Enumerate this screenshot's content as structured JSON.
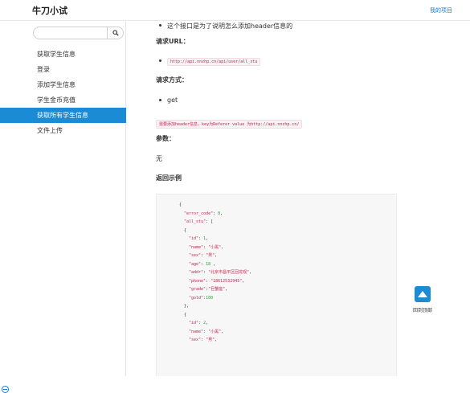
{
  "header": {
    "brand": "牛刀小试",
    "my_projects": "我的项目"
  },
  "sidebar": {
    "search_value": "",
    "items": [
      {
        "label": "获取学生信息",
        "active": false
      },
      {
        "label": "登录",
        "active": false
      },
      {
        "label": "添加学生信息",
        "active": false
      },
      {
        "label": "学生金币充值",
        "active": false
      },
      {
        "label": "获取所有学生信息",
        "active": true
      },
      {
        "label": "文件上传",
        "active": false
      }
    ]
  },
  "content": {
    "intro_bullet": "这个接口是为了说明怎么添加header信息的",
    "url_heading": "请求URL：",
    "url": "http://api.nnzhp.cn/api/user/all_stu",
    "method_heading": "请求方式：",
    "method": "get",
    "note": "需要添加header信息，key为Referer value 为http://api.nnzhp.cn/",
    "params_heading": "参数：",
    "params": "无",
    "example_heading": "返回示例",
    "code_lines": [
      {
        "indent": 0,
        "parts": [
          {
            "t": "{",
            "c": ""
          }
        ]
      },
      {
        "indent": 1,
        "parts": [
          {
            "t": "\"error_code\"",
            "c": "k"
          },
          {
            "t": ": ",
            "c": ""
          },
          {
            "t": "0",
            "c": "n"
          },
          {
            "t": ",",
            "c": ""
          }
        ]
      },
      {
        "indent": 1,
        "parts": [
          {
            "t": "\"all_stu\"",
            "c": "k"
          },
          {
            "t": ": [",
            "c": ""
          }
        ]
      },
      {
        "indent": 1,
        "parts": [
          {
            "t": "{",
            "c": ""
          }
        ]
      },
      {
        "indent": 2,
        "parts": [
          {
            "t": "\"id\"",
            "c": "k"
          },
          {
            "t": ": ",
            "c": ""
          },
          {
            "t": "1",
            "c": "n"
          },
          {
            "t": ",",
            "c": ""
          }
        ]
      },
      {
        "indent": 2,
        "parts": [
          {
            "t": "\"name\"",
            "c": "k"
          },
          {
            "t": ": ",
            "c": ""
          },
          {
            "t": "\"小黑\"",
            "c": "s"
          },
          {
            "t": ",",
            "c": ""
          }
        ]
      },
      {
        "indent": 2,
        "parts": [
          {
            "t": "\"sex\"",
            "c": "k"
          },
          {
            "t": ": ",
            "c": ""
          },
          {
            "t": "\"男\"",
            "c": "s"
          },
          {
            "t": ",",
            "c": ""
          }
        ]
      },
      {
        "indent": 2,
        "parts": [
          {
            "t": "\"age\"",
            "c": "k"
          },
          {
            "t": ": ",
            "c": ""
          },
          {
            "t": "18",
            "c": "n"
          },
          {
            "t": " ,",
            "c": ""
          }
        ]
      },
      {
        "indent": 2,
        "parts": [
          {
            "t": "\"addr\"",
            "c": "k"
          },
          {
            "t": ": ",
            "c": ""
          },
          {
            "t": "\"北京市昌平区回龙观\"",
            "c": "s"
          },
          {
            "t": ",",
            "c": ""
          }
        ]
      },
      {
        "indent": 2,
        "parts": [
          {
            "t": "\"phone\"",
            "c": "k"
          },
          {
            "t": ": ",
            "c": ""
          },
          {
            "t": "\"18612532945\"",
            "c": "s"
          },
          {
            "t": ",",
            "c": ""
          }
        ]
      },
      {
        "indent": 2,
        "parts": [
          {
            "t": "\"grade\"",
            "c": "k"
          },
          {
            "t": ":",
            "c": ""
          },
          {
            "t": "\"巨蟹座\"",
            "c": "s"
          },
          {
            "t": ",",
            "c": ""
          }
        ]
      },
      {
        "indent": 2,
        "parts": [
          {
            "t": "\"gold\"",
            "c": "k"
          },
          {
            "t": ":",
            "c": ""
          },
          {
            "t": "100",
            "c": "n"
          }
        ]
      },
      {
        "indent": 1,
        "parts": [
          {
            "t": "},",
            "c": ""
          }
        ]
      },
      {
        "indent": 1,
        "parts": [
          {
            "t": "{",
            "c": ""
          }
        ]
      },
      {
        "indent": 2,
        "parts": [
          {
            "t": "\"id\"",
            "c": "k"
          },
          {
            "t": ": ",
            "c": ""
          },
          {
            "t": "2",
            "c": "n"
          },
          {
            "t": ",",
            "c": ""
          }
        ]
      },
      {
        "indent": 2,
        "parts": [
          {
            "t": "\"name\"",
            "c": "k"
          },
          {
            "t": ": ",
            "c": ""
          },
          {
            "t": "\"小黑\"",
            "c": "s"
          },
          {
            "t": ",",
            "c": ""
          }
        ]
      },
      {
        "indent": 2,
        "parts": [
          {
            "t": "\"sex\"",
            "c": "k"
          },
          {
            "t": ": ",
            "c": ""
          },
          {
            "t": "\"男\"",
            "c": "s"
          },
          {
            "t": ",",
            "c": ""
          }
        ]
      }
    ]
  },
  "back_to_top": "回到顶部",
  "colors": {
    "accent": "#1b8bd6",
    "link": "#1a7bd1",
    "code_key": "#c7254e",
    "code_number": "#2a9d3f"
  }
}
